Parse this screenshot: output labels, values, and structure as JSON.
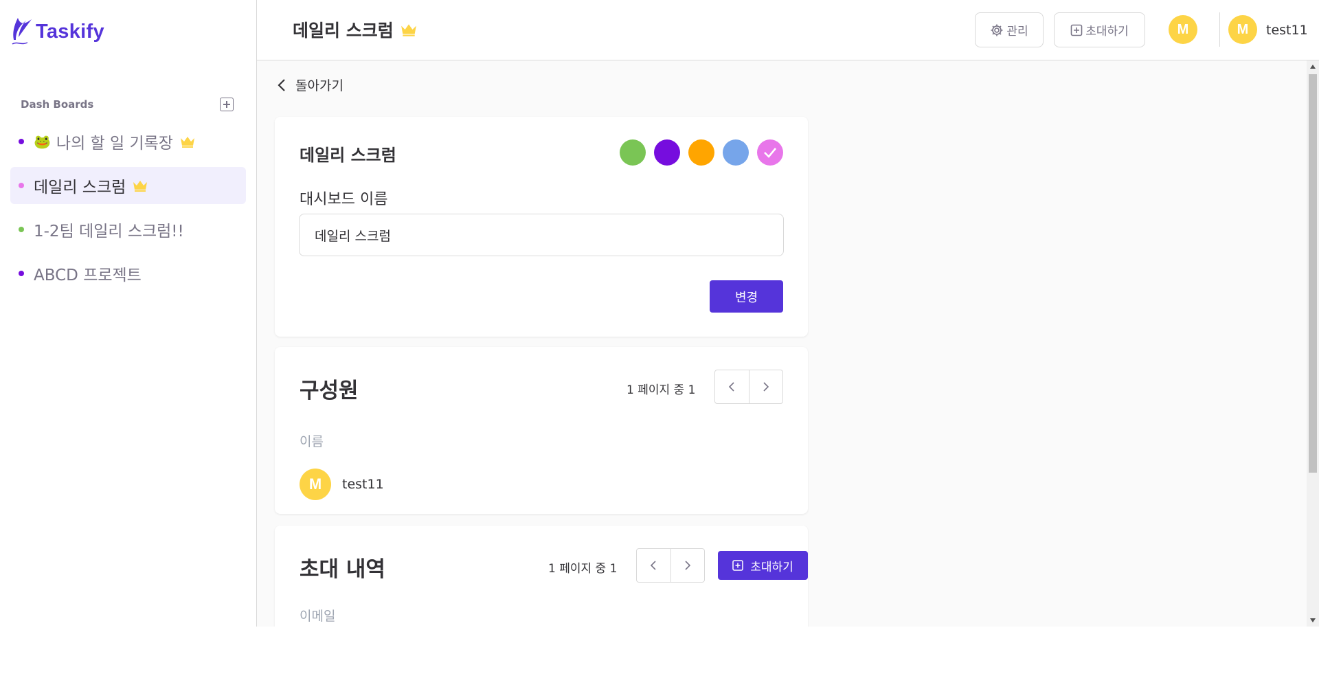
{
  "app": {
    "logo_text": "Taskify"
  },
  "sidebar": {
    "section_title": "Dash Boards",
    "boards": [
      {
        "label": "나의 할 일 기록장",
        "emoji": "🐸",
        "color": "#7ac555",
        "owner_crown": true,
        "active": false
      },
      {
        "label": "데일리 스크럼",
        "color": "#e876ea",
        "owner_crown": true,
        "active": true
      },
      {
        "label": "1-2팀 데일리 스크럼!!",
        "color": "#7ac555",
        "owner_crown": false,
        "active": false
      },
      {
        "label": "ABCD 프로젝트",
        "color": "#760dde",
        "owner_crown": false,
        "active": false
      }
    ]
  },
  "header": {
    "title": "데일리 스크럼",
    "manage_label": "관리",
    "invite_label": "초대하기",
    "member_avatar_initial": "M",
    "user_avatar_initial": "M",
    "user_name": "test11"
  },
  "back_label": "돌아가기",
  "edit_card": {
    "title": "데일리 스크럼",
    "colors": [
      {
        "name": "green",
        "hex": "#7ac555",
        "selected": false
      },
      {
        "name": "purple",
        "hex": "#760dde",
        "selected": false
      },
      {
        "name": "orange",
        "hex": "#ffa500",
        "selected": false
      },
      {
        "name": "blue",
        "hex": "#76a5ea",
        "selected": false
      },
      {
        "name": "pink",
        "hex": "#e876ea",
        "selected": true
      }
    ],
    "field_label": "대시보드 이름",
    "field_value": "데일리 스크럼",
    "submit_label": "변경"
  },
  "members_card": {
    "title": "구성원",
    "page_info": "1 페이지 중 1",
    "column_name": "이름",
    "members": [
      {
        "initial": "M",
        "name": "test11"
      }
    ]
  },
  "invites_card": {
    "title": "초대 내역",
    "page_info": "1 페이지 중 1",
    "invite_button_label": "초대하기",
    "column_email": "이메일"
  },
  "colors": {
    "primary": "#5534da",
    "avatar": "#fdd446",
    "crown": "#fdd446"
  }
}
